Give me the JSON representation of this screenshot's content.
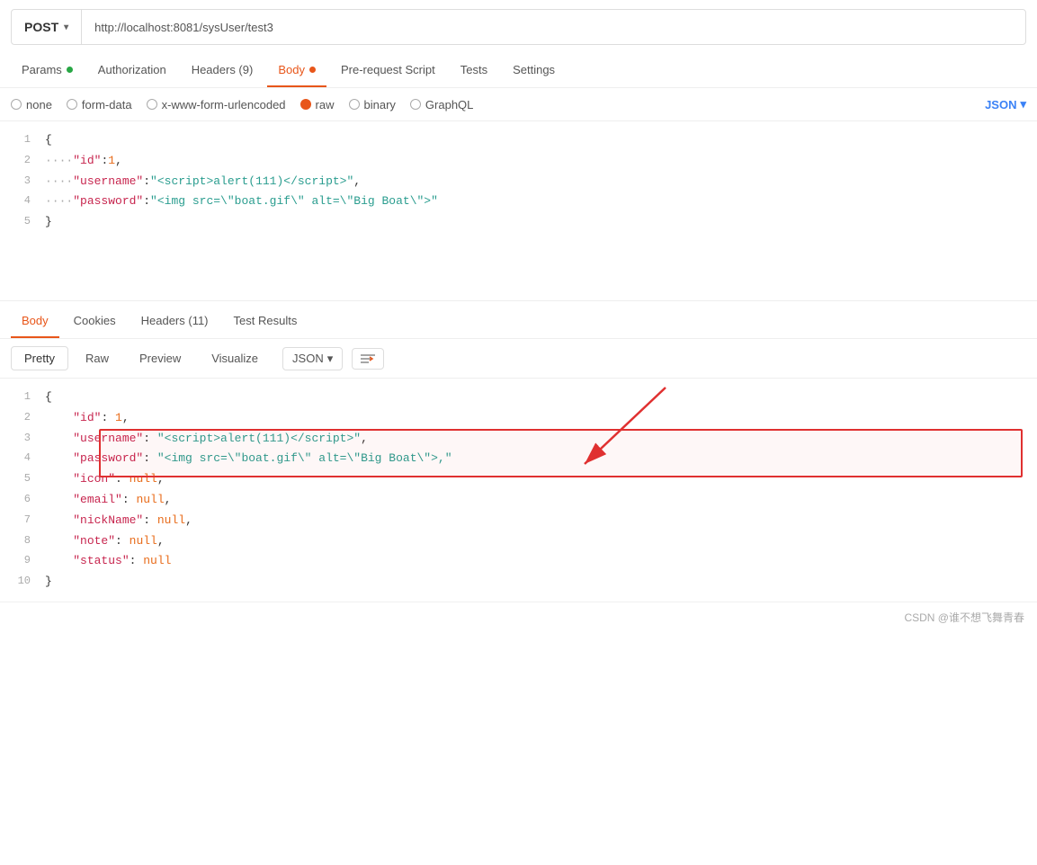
{
  "urlBar": {
    "method": "POST",
    "url": "http://localhost:8081/sysUser/test3"
  },
  "requestTabs": [
    {
      "label": "Params",
      "hasDot": true,
      "dotColor": "green",
      "active": false
    },
    {
      "label": "Authorization",
      "hasDot": false,
      "active": false
    },
    {
      "label": "Headers (9)",
      "hasDot": false,
      "active": false
    },
    {
      "label": "Body",
      "hasDot": true,
      "dotColor": "orange",
      "active": true
    },
    {
      "label": "Pre-request Script",
      "hasDot": false,
      "active": false
    },
    {
      "label": "Tests",
      "hasDot": false,
      "active": false
    },
    {
      "label": "Settings",
      "hasDot": false,
      "active": false
    }
  ],
  "bodyTypes": [
    {
      "label": "none",
      "active": false
    },
    {
      "label": "form-data",
      "active": false
    },
    {
      "label": "x-www-form-urlencoded",
      "active": false
    },
    {
      "label": "raw",
      "active": true
    },
    {
      "label": "binary",
      "active": false
    },
    {
      "label": "GraphQL",
      "active": false
    }
  ],
  "jsonSelector": "JSON",
  "requestBody": [
    {
      "num": "1",
      "content": "{"
    },
    {
      "num": "2",
      "content": "    \"id\":1,"
    },
    {
      "num": "3",
      "content": "    \"username\":\"<script>alert(111)<\\/script>\","
    },
    {
      "num": "4",
      "content": "    \"password\":\"<img src=\\\"boat.gif\\\" alt=\\\"Big Boat\\\">\""
    },
    {
      "num": "5",
      "content": "}"
    }
  ],
  "responseTabs": [
    {
      "label": "Body",
      "active": true
    },
    {
      "label": "Cookies",
      "active": false
    },
    {
      "label": "Headers (11)",
      "active": false
    },
    {
      "label": "Test Results",
      "active": false
    }
  ],
  "formatButtons": [
    {
      "label": "Pretty",
      "active": true
    },
    {
      "label": "Raw",
      "active": false
    },
    {
      "label": "Preview",
      "active": false
    },
    {
      "label": "Visualize",
      "active": false
    }
  ],
  "responseFormatSelector": "JSON",
  "responseBody": [
    {
      "num": "1",
      "parts": [
        {
          "text": "{",
          "cls": "c-brace"
        }
      ]
    },
    {
      "num": "2",
      "parts": [
        {
          "text": "    ",
          "cls": ""
        },
        {
          "text": "\"id\"",
          "cls": "c-key"
        },
        {
          "text": ": ",
          "cls": "c-brace"
        },
        {
          "text": "1",
          "cls": "c-num"
        },
        {
          "text": ",",
          "cls": "c-brace"
        }
      ]
    },
    {
      "num": "3",
      "parts": [
        {
          "text": "    ",
          "cls": ""
        },
        {
          "text": "\"username\"",
          "cls": "c-key"
        },
        {
          "text": ": ",
          "cls": "c-brace"
        },
        {
          "text": "\"<script>alert(111)<\\/script>\"",
          "cls": "c-string"
        },
        {
          "text": ",",
          "cls": "c-brace"
        }
      ]
    },
    {
      "num": "4",
      "parts": [
        {
          "text": "    ",
          "cls": ""
        },
        {
          "text": "\"password\"",
          "cls": "c-key"
        },
        {
          "text": ": ",
          "cls": "c-brace"
        },
        {
          "text": "\"<img src=\\\"boat.gif\\\" alt=\\\"Big Boat\\\">,\"",
          "cls": "c-string"
        }
      ]
    },
    {
      "num": "5",
      "parts": [
        {
          "text": "    ",
          "cls": ""
        },
        {
          "text": "\"icon\"",
          "cls": "c-key"
        },
        {
          "text": ": ",
          "cls": "c-brace"
        },
        {
          "text": "null",
          "cls": "c-num"
        },
        {
          "text": ",",
          "cls": "c-brace"
        }
      ]
    },
    {
      "num": "6",
      "parts": [
        {
          "text": "    ",
          "cls": ""
        },
        {
          "text": "\"email\"",
          "cls": "c-key"
        },
        {
          "text": ": ",
          "cls": "c-brace"
        },
        {
          "text": "null",
          "cls": "c-num"
        },
        {
          "text": ",",
          "cls": "c-brace"
        }
      ]
    },
    {
      "num": "7",
      "parts": [
        {
          "text": "    ",
          "cls": ""
        },
        {
          "text": "\"nickName\"",
          "cls": "c-key"
        },
        {
          "text": ": ",
          "cls": "c-brace"
        },
        {
          "text": "null",
          "cls": "c-num"
        },
        {
          "text": ",",
          "cls": "c-brace"
        }
      ]
    },
    {
      "num": "8",
      "parts": [
        {
          "text": "    ",
          "cls": ""
        },
        {
          "text": "\"note\"",
          "cls": "c-key"
        },
        {
          "text": ": ",
          "cls": "c-brace"
        },
        {
          "text": "null",
          "cls": "c-num"
        },
        {
          "text": ",",
          "cls": "c-brace"
        }
      ]
    },
    {
      "num": "9",
      "parts": [
        {
          "text": "    ",
          "cls": ""
        },
        {
          "text": "\"status\"",
          "cls": "c-key"
        },
        {
          "text": ": ",
          "cls": "c-brace"
        },
        {
          "text": "null",
          "cls": "c-num"
        }
      ]
    },
    {
      "num": "10",
      "parts": [
        {
          "text": "}",
          "cls": "c-brace"
        }
      ]
    }
  ],
  "footer": "CSDN @谁不想飞舞青春"
}
